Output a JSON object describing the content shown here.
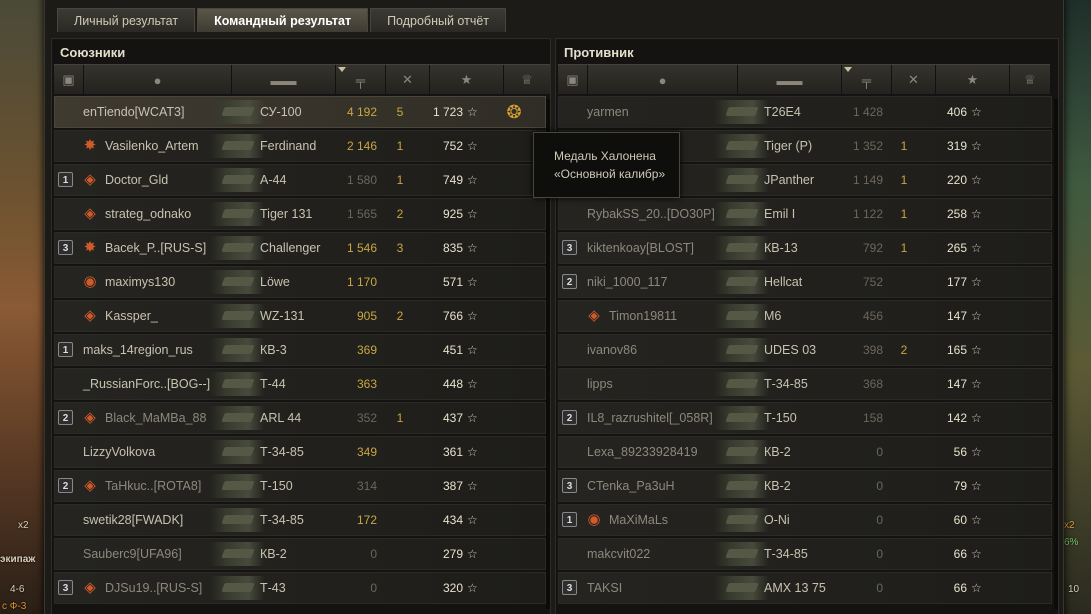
{
  "tabs": [
    {
      "label": "Личный результат"
    },
    {
      "label": "Командный результат"
    },
    {
      "label": "Подробный отчёт"
    }
  ],
  "left": {
    "title": "Союзники",
    "rows": [
      {
        "plat": "",
        "icon": "",
        "name": "enTiendo[WCAT3]",
        "tank": "СУ-100",
        "dmg": "4 192",
        "kills": "5",
        "xp": "1 723",
        "medal": "award-medal-icon",
        "hl": true
      },
      {
        "plat": "",
        "icon": "star-badge-icon",
        "name": "Vasilenko_Artem",
        "tank": "Ferdinand",
        "dmg": "2 146",
        "kills": "1",
        "xp": "752"
      },
      {
        "plat": "1",
        "icon": "diamond-icon",
        "name": "Doctor_Gld",
        "tank": "A-44",
        "dmg": "1 580",
        "kills": "1",
        "xp": "749",
        "dimdmg": true
      },
      {
        "plat": "",
        "icon": "diamond-icon",
        "name": "strateg_odnako",
        "tank": "Tiger 131",
        "dmg": "1 565",
        "kills": "2",
        "xp": "925",
        "dimdmg": true
      },
      {
        "plat": "3",
        "icon": "star-badge-icon",
        "name": "Bacek_P..[RUS-S]",
        "tank": "Challenger",
        "dmg": "1 546",
        "kills": "3",
        "xp": "835"
      },
      {
        "plat": "",
        "icon": "seal-icon",
        "name": "maximys130",
        "tank": "Löwe",
        "dmg": "1 170",
        "kills": "",
        "xp": "571"
      },
      {
        "plat": "",
        "icon": "diamond-icon",
        "name": "Kassper_",
        "tank": "WZ-131",
        "dmg": "905",
        "kills": "2",
        "xp": "766"
      },
      {
        "plat": "1",
        "icon": "",
        "name": "maks_14region_rus",
        "tank": "КВ-3",
        "dmg": "369",
        "kills": "",
        "xp": "451"
      },
      {
        "plat": "",
        "icon": "",
        "name": "_RussianForc..[BOG--]",
        "tank": "Т-44",
        "dmg": "363",
        "kills": "",
        "xp": "448"
      },
      {
        "plat": "2",
        "icon": "diamond-icon",
        "name": "Black_MaMBa_88",
        "tank": "ARL 44",
        "dmg": "352",
        "kills": "1",
        "xp": "437",
        "dimdmg": true,
        "dim": true
      },
      {
        "plat": "",
        "icon": "",
        "name": "LizzyVolkova",
        "tank": "Т-34-85",
        "dmg": "349",
        "kills": "",
        "xp": "361"
      },
      {
        "plat": "2",
        "icon": "diamond-icon",
        "name": "TaHkuc..[ROTA8]",
        "tank": "Т-150",
        "dmg": "314",
        "kills": "",
        "xp": "387",
        "dimdmg": true,
        "dim": true
      },
      {
        "plat": "",
        "icon": "",
        "name": "swetik28[FWADK]",
        "tank": "Т-34-85",
        "dmg": "172",
        "kills": "",
        "xp": "434"
      },
      {
        "plat": "",
        "icon": "",
        "name": "Sauberc9[UFA96]",
        "tank": "КВ-2",
        "dmg": "0",
        "kills": "",
        "xp": "279",
        "dimdmg": true,
        "dim": true
      },
      {
        "plat": "3",
        "icon": "diamond-icon",
        "name": "DJSu19..[RUS-S]",
        "tank": "Т-43",
        "dmg": "0",
        "kills": "",
        "xp": "320",
        "dimdmg": true,
        "dim": true
      }
    ]
  },
  "right": {
    "title": "Противник",
    "rows": [
      {
        "plat": "",
        "icon": "",
        "name": "yarmen",
        "tank": "T26E4",
        "dmg": "1 428",
        "kills": "",
        "xp": "406",
        "dim": true
      },
      {
        "plat": "",
        "icon": "",
        "name": "",
        "tank": "Tiger (P)",
        "dmg": "1 352",
        "kills": "1",
        "xp": "319",
        "dim": true
      },
      {
        "plat": "",
        "icon": "",
        "name": "",
        "tank": "JPanther",
        "dmg": "1 149",
        "kills": "1",
        "xp": "220",
        "dim": true
      },
      {
        "plat": "",
        "icon": "",
        "name": "RybakSS_20..[DO30P]",
        "tank": "Emil I",
        "dmg": "1 122",
        "kills": "1",
        "xp": "258",
        "dim": true
      },
      {
        "plat": "3",
        "icon": "",
        "name": "kiktenkoay[BLOST]",
        "tank": "КВ-13",
        "dmg": "792",
        "kills": "1",
        "xp": "265",
        "dim": true
      },
      {
        "plat": "2",
        "icon": "",
        "name": "niki_1000_117",
        "tank": "Hellcat",
        "dmg": "752",
        "kills": "",
        "xp": "177",
        "dim": true
      },
      {
        "plat": "",
        "icon": "diamond-icon",
        "name": "Timon19811",
        "tank": "M6",
        "dmg": "456",
        "kills": "",
        "xp": "147",
        "dim": true
      },
      {
        "plat": "",
        "icon": "",
        "name": "ivanov86",
        "tank": "UDES 03",
        "dmg": "398",
        "kills": "2",
        "xp": "165",
        "dim": true
      },
      {
        "plat": "",
        "icon": "",
        "name": "lipps",
        "tank": "Т-34-85",
        "dmg": "368",
        "kills": "",
        "xp": "147",
        "dim": true
      },
      {
        "plat": "2",
        "icon": "",
        "name": "IL8_razrushitel[_058R]",
        "tank": "Т-150",
        "dmg": "158",
        "kills": "",
        "xp": "142",
        "dim": true
      },
      {
        "plat": "",
        "icon": "",
        "name": "Lexa_89233928419",
        "tank": "КВ-2",
        "dmg": "0",
        "kills": "",
        "xp": "56",
        "dim": true
      },
      {
        "plat": "3",
        "icon": "",
        "name": "CTenka_Pa3uH",
        "tank": "КВ-2",
        "dmg": "0",
        "kills": "",
        "xp": "79",
        "dim": true
      },
      {
        "plat": "1",
        "icon": "seal-icon",
        "name": "MaXiMaLs",
        "tank": "O-Ni",
        "dmg": "0",
        "kills": "",
        "xp": "60",
        "dim": true
      },
      {
        "plat": "",
        "icon": "",
        "name": "makcvit022",
        "tank": "Т-34-85",
        "dmg": "0",
        "kills": "",
        "xp": "66",
        "dim": true
      },
      {
        "plat": "3",
        "icon": "",
        "name": "TAKSI",
        "tank": "AMX 13 75",
        "dmg": "0",
        "kills": "",
        "xp": "66",
        "dim": true
      }
    ]
  },
  "tooltip": {
    "line1": "Медаль Халонена",
    "line2": "«Основной калибр»"
  },
  "side": {
    "left1": "экипаж",
    "left2": "4-6",
    "left3": "с Ф-3",
    "left4": "x2",
    "right1": "x2",
    "right2": "6%",
    "right3": "10"
  },
  "star_glyph": "☆"
}
